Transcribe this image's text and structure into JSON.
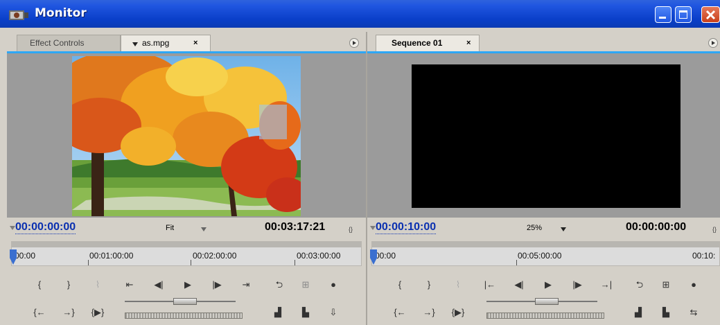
{
  "window": {
    "title": "Monitor"
  },
  "colors": {
    "titlebar": "#0a3fc9",
    "accent": "#2da7f5",
    "timecode_blue": "#0a30b0"
  },
  "source_panel": {
    "tabs": [
      {
        "label": "Effect Controls",
        "active": false
      },
      {
        "label": "as.mpg",
        "active": true,
        "has_dropdown": true,
        "close": "×"
      }
    ],
    "timecode_current": "00:00:00:00",
    "zoom_label": "Fit",
    "timecode_duration": "00:03:17:21",
    "ruler_labels": [
      "00:00",
      "00:01:00:00",
      "00:02:00:00",
      "00:03:00:00"
    ],
    "image": "autumn-tree-photo"
  },
  "program_panel": {
    "tabs": [
      {
        "label": "Sequence 01",
        "active": true,
        "close": "×"
      }
    ],
    "timecode_current": "00:00:10:00",
    "zoom_label": "25%",
    "timecode_duration": "00:00:00:00",
    "ruler_labels": [
      "00:00",
      "00:05:00:00",
      "00:10:"
    ]
  },
  "controls": {
    "source_row1": [
      "set-in-icon",
      "set-out-icon",
      "set-marker-icon",
      "go-to-in-icon",
      "step-back-icon",
      "play-icon",
      "step-forward-icon",
      "go-to-out-icon",
      "loop-icon",
      "safe-margins-icon",
      "output-icon"
    ],
    "source_row2": [
      "go-to-in-icon",
      "go-to-out-icon",
      "play-in-to-out-icon",
      "shuttle-slider",
      "jog-wheel",
      "insert-icon",
      "overlay-icon",
      "extract-icon"
    ]
  }
}
